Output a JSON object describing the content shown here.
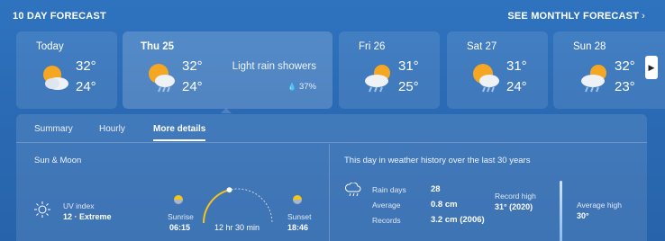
{
  "header": {
    "title": "10 DAY FORECAST",
    "monthly_link": "SEE MONTHLY FORECAST",
    "monthly_chevron": "›"
  },
  "days": [
    {
      "name": "Today",
      "high": "32°",
      "low": "24°",
      "icon": "partly-cloudy-sun-icon"
    },
    {
      "name": "Thu 25",
      "high": "32°",
      "low": "24°",
      "icon": "sun-cloud-rain-icon",
      "condition": "Light rain showers",
      "precip": "37%",
      "selected": true
    },
    {
      "name": "Fri 26",
      "high": "31°",
      "low": "25°",
      "icon": "sun-cloud-rain-icon"
    },
    {
      "name": "Sat 27",
      "high": "31°",
      "low": "24°",
      "icon": "sun-cloud-rain-icon"
    },
    {
      "name": "Sun 28",
      "high": "32°",
      "low": "23°",
      "icon": "sun-cloud-rain-icon"
    }
  ],
  "next_arrow": "▶",
  "tabs": [
    {
      "label": "Summary"
    },
    {
      "label": "Hourly"
    },
    {
      "label": "More details",
      "active": true
    }
  ],
  "sun_moon": {
    "heading": "Sun & Moon",
    "uv_label": "UV index",
    "uv_value": "12 · Extreme",
    "sunrise_label": "Sunrise",
    "sunrise_time": "06:15",
    "day_length": "12 hr 30 min",
    "sunset_label": "Sunset",
    "sunset_time": "18:46",
    "day_progress": 0.42
  },
  "history": {
    "heading": "This day in weather history over the last 30 years",
    "rain_days_label": "Rain days",
    "rain_days_value": "28",
    "average_label": "Average",
    "average_value": "0.8 cm",
    "records_label": "Records",
    "records_value": "3.2 cm (2006)",
    "record_high_label": "Record high",
    "record_high_value": "31° (2020)",
    "average_high_label": "Average high",
    "average_high_value": "30°"
  },
  "colors": {
    "background": "#2b6bb5",
    "sun": "#f5a623",
    "arc": "#f5c518"
  }
}
